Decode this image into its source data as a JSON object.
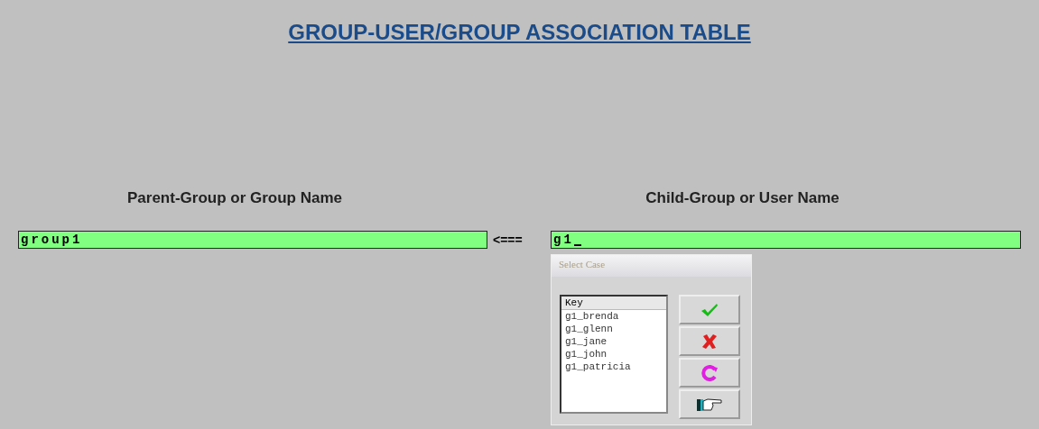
{
  "title": "GROUP-USER/GROUP ASSOCIATION TABLE",
  "columns": [
    {
      "heading": "Parent-Group or Group Name",
      "value": "group1"
    },
    {
      "heading": "Child-Group or User Name",
      "value": "g1"
    }
  ],
  "arrow": "<===",
  "popup": {
    "title": "Select Case",
    "list_header": "Key",
    "items": [
      "g1_brenda",
      "g1_glenn",
      "g1_jane",
      "g1_john",
      "g1_patricia"
    ],
    "buttons": [
      {
        "kind": "ok"
      },
      {
        "kind": "cancel"
      },
      {
        "kind": "refresh"
      },
      {
        "kind": "point"
      }
    ]
  }
}
